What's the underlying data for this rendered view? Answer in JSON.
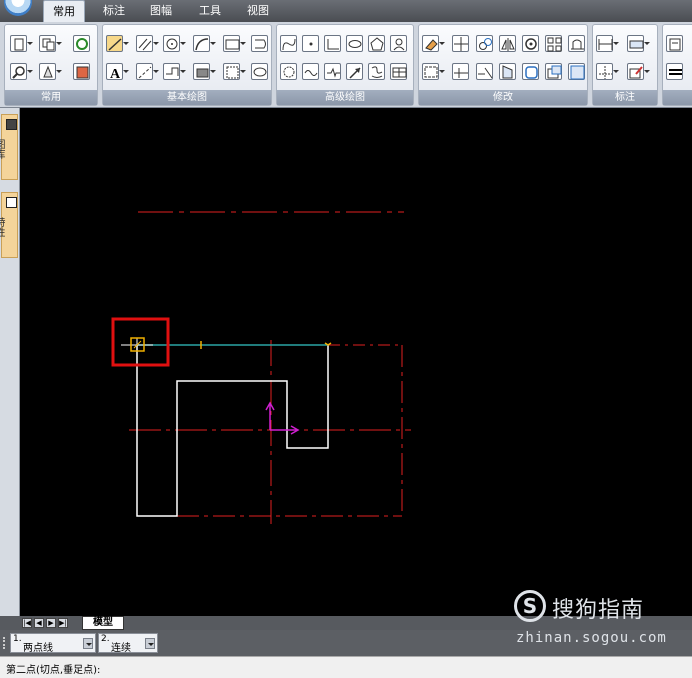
{
  "menu": {
    "tabs": [
      "常用",
      "标注",
      "图幅",
      "工具",
      "视图"
    ],
    "active": "常用"
  },
  "ribbon": {
    "groups": [
      "常用",
      "基本绘图",
      "高级绘图",
      "修改",
      "标注"
    ]
  },
  "palette": {
    "tabs": [
      "图库",
      "特性"
    ]
  },
  "layout": {
    "model_tab": "模型"
  },
  "options": {
    "opt1_num": "1.",
    "opt1_value": "两点线",
    "opt2_num": "2.",
    "opt2_value": "连续"
  },
  "status": {
    "prompt": "第二点(切点,垂足点):"
  },
  "watermark": {
    "brand": "搜狗指南",
    "url": "zhinan.sogou.com",
    "logo": "S"
  },
  "colors": {
    "canvas": "#000000",
    "centerline": "#e02020",
    "geometry": "#ffffff",
    "preview_line": "#2aa6a6",
    "ucs": "#d020d0",
    "highlight": "#e01010",
    "snap_marker": "#f0b000"
  }
}
